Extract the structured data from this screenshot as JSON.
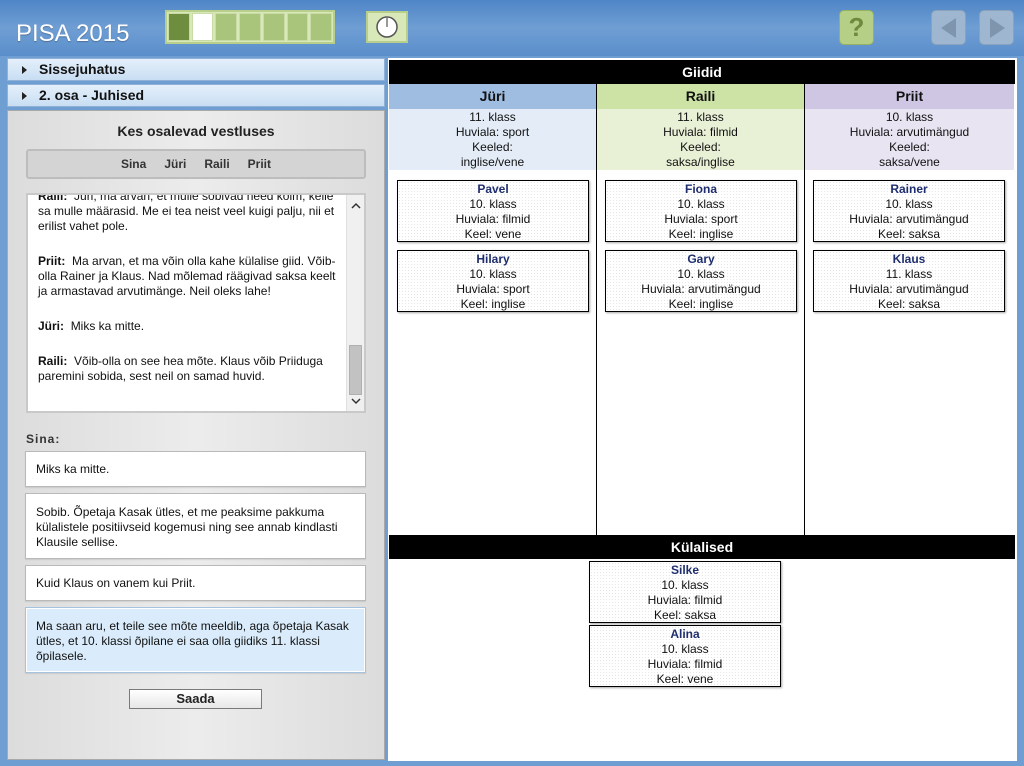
{
  "app": {
    "title": "PISA 2015"
  },
  "toolbar": {
    "progress_segments": [
      "done",
      "current",
      "todo",
      "todo",
      "todo",
      "todo",
      "todo"
    ],
    "help_label": "?"
  },
  "accordion": {
    "intro": "Sissejuhatus",
    "part2": "2. osa - Juhised"
  },
  "chat": {
    "title": "Kes osalevad vestluses",
    "participants": [
      "Sina",
      "Jüri",
      "Raili",
      "Priit"
    ],
    "messages": [
      {
        "speaker": "Raili:",
        "text": "Jüri, ma arvan, et mulle sobivad need kolm, kelle sa mulle määrasid. Me ei tea neist veel kuigi palju, nii et erilist vahet pole."
      },
      {
        "speaker": "Priit:",
        "text": "Ma arvan, et ma võin olla kahe külalise giid. Võib-olla Rainer ja Klaus. Nad mõlemad räägivad saksa keelt ja armastavad arvutimänge. Neil oleks lahe!"
      },
      {
        "speaker": "Jüri:",
        "text": "Miks ka mitte."
      },
      {
        "speaker": "Raili:",
        "text": "Võib-olla on see hea mõte. Klaus võib Priiduga paremini sobida, sest neil on samad huvid."
      }
    ],
    "you_label": "Sina:",
    "options": [
      "Miks ka mitte.",
      "Sobib. Õpetaja Kasak ütles, et me peaksime pakkuma külalistele positiivseid kogemusi ning see annab kindlasti Klausile sellise.",
      "Kuid Klaus on vanem kui Priit.",
      "Ma saan aru, et teile see mõte meeldib, aga õpetaja Kasak ütles, et 10. klassi õpilane ei saa olla giidiks 11. klassi õpilasele."
    ],
    "selected_option": 4,
    "send_label": "Saada"
  },
  "guides": {
    "title": "Giidid",
    "columns": [
      {
        "name": "Jüri",
        "info": [
          "11. klass",
          "Huviala: sport",
          "Keeled:",
          "inglise/vene"
        ],
        "cards": [
          {
            "name": "Pavel",
            "lines": [
              "10. klass",
              "Huviala: filmid",
              "Keel: vene"
            ]
          },
          {
            "name": "Hilary",
            "lines": [
              "10. klass",
              "Huviala: sport",
              "Keel: inglise"
            ]
          }
        ]
      },
      {
        "name": "Raili",
        "info": [
          "11. klass",
          "Huviala: filmid",
          "Keeled:",
          "saksa/inglise"
        ],
        "cards": [
          {
            "name": "Fiona",
            "lines": [
              "10. klass",
              "Huviala: sport",
              "Keel: inglise"
            ]
          },
          {
            "name": "Gary",
            "lines": [
              "10. klass",
              "Huviala: arvutimängud",
              "Keel: inglise"
            ]
          }
        ]
      },
      {
        "name": "Priit",
        "info": [
          "10. klass",
          "Huviala: arvutimängud",
          "Keeled:",
          "saksa/vene"
        ],
        "cards": [
          {
            "name": "Rainer",
            "lines": [
              "10. klass",
              "Huviala: arvutimängud",
              "Keel: saksa"
            ]
          },
          {
            "name": "Klaus",
            "lines": [
              "11. klass",
              "Huviala: arvutimängud",
              "Keel: saksa"
            ]
          }
        ]
      }
    ]
  },
  "guests": {
    "title": "Külalised",
    "cards": [
      {
        "name": "Silke",
        "lines": [
          "10. klass",
          "Huviala: filmid",
          "Keel: saksa"
        ]
      },
      {
        "name": "Alina",
        "lines": [
          "10. klass",
          "Huviala: filmid",
          "Keel: vene"
        ]
      }
    ]
  },
  "colors": {
    "topbar": "#5a8ecb",
    "juri": "#9fbde0",
    "raili": "#cde3a6",
    "priit": "#cec6e2",
    "selected_option": "#daecfb"
  },
  "icons": {
    "clock": "clock-icon",
    "help": "help-icon",
    "prev": "arrow-left-icon",
    "next": "arrow-right-icon"
  }
}
